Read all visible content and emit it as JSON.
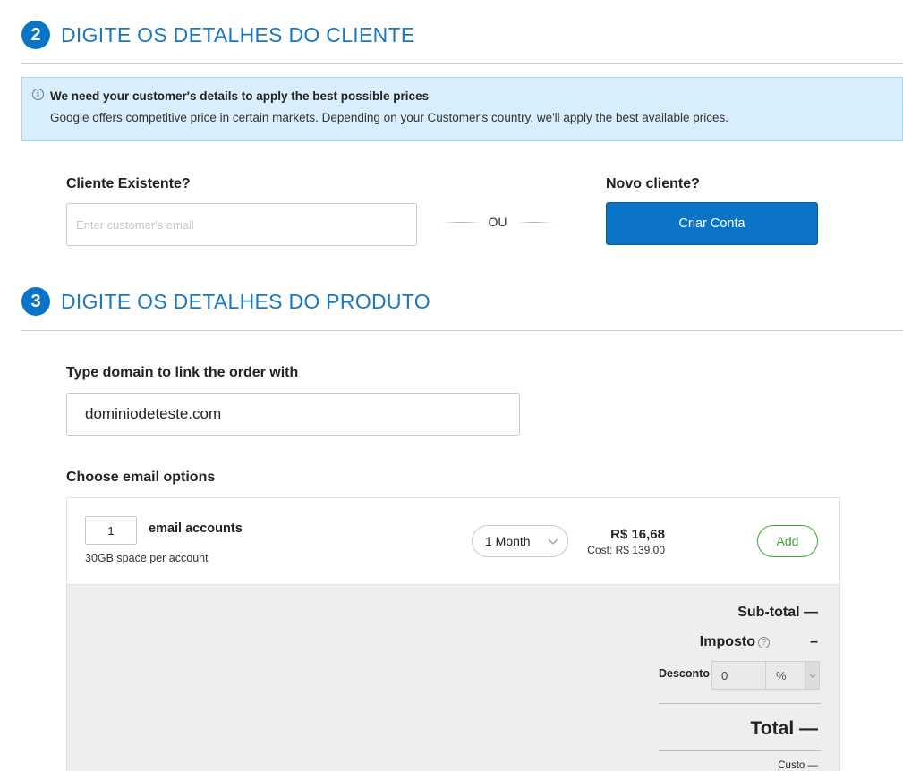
{
  "section_customer": {
    "number": "2",
    "title": "DIGITE OS DETALHES DO CLIENTE"
  },
  "info_box": {
    "title": "We need your customer's details to apply the best possible prices",
    "body": "Google offers competitive price in certain markets. Depending on your Customer's country, we'll apply the best available prices."
  },
  "existing_customer": {
    "label": "Cliente Existente?",
    "email_placeholder": "Enter customer's email",
    "email_value": ""
  },
  "divider": {
    "or_text": "OU"
  },
  "new_customer": {
    "label": "Novo cliente?",
    "button_label": "Criar Conta"
  },
  "section_product": {
    "number": "3",
    "title": "DIGITE OS DETALHES DO PRODUTO"
  },
  "domain": {
    "label": "Type domain to link the order with",
    "value": "dominiodeteste.com"
  },
  "email_options": {
    "label": "Choose email options",
    "quantity": "1",
    "accounts_label": "email accounts",
    "space_note": "30GB space per account",
    "term": "1 Month",
    "price": "R$ 16,68",
    "cost": "Cost: R$ 139,00",
    "add_label": "Add"
  },
  "summary": {
    "subtotal": "Sub-total —",
    "tax_label": "Imposto",
    "tax_value": "–",
    "discount_label": "Desconto",
    "discount_value": "0",
    "discount_unit": "%",
    "total": "Total —",
    "cost": "Custo —"
  },
  "colors": {
    "brand_blue": "#0a74c9",
    "add_green": "#3aa43a",
    "info_bg": "#d8eefc"
  }
}
